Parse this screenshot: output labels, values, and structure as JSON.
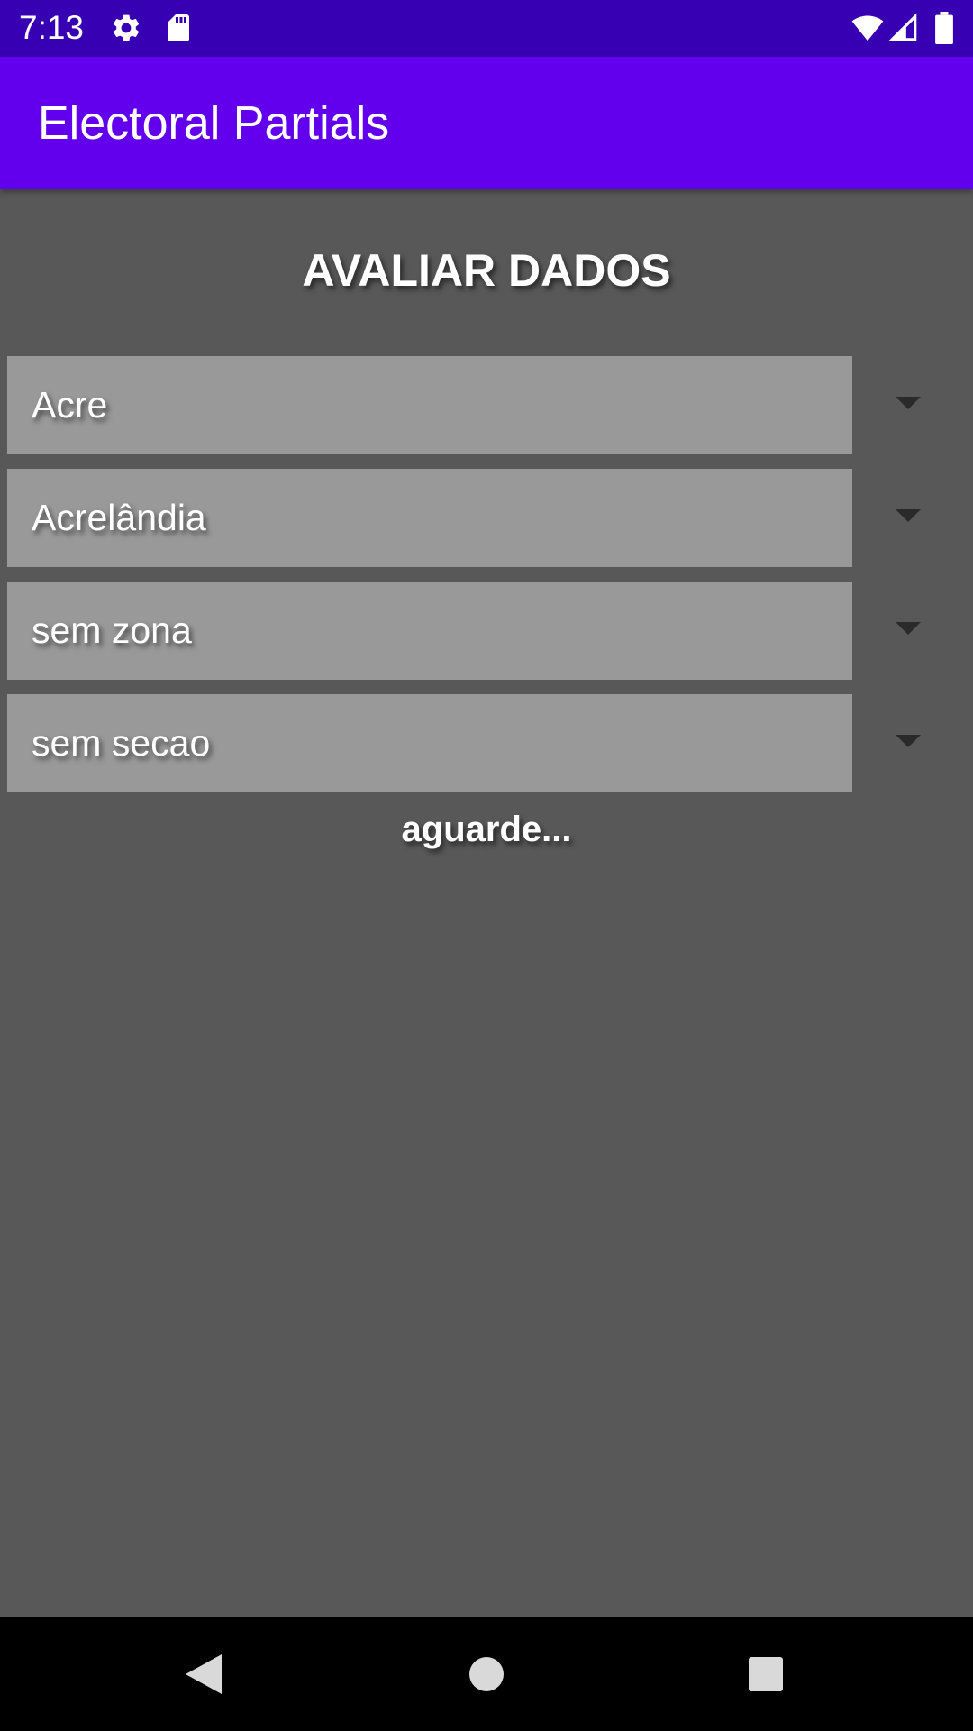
{
  "status_bar": {
    "time": "7:13",
    "icons": [
      "settings-icon",
      "sd-card-icon",
      "wifi-icon",
      "cell-signal-icon",
      "battery-icon"
    ]
  },
  "app_bar": {
    "title": "Electoral Partials",
    "color": "#6200ee"
  },
  "main": {
    "heading": "AVALIAR DADOS",
    "dropdowns": [
      {
        "selected": "Acre"
      },
      {
        "selected": "Acrelândia"
      },
      {
        "selected": "sem zona"
      },
      {
        "selected": "sem secao"
      }
    ],
    "loading_text": "aguarde..."
  },
  "navigation_bar": {
    "icons": [
      "back-icon",
      "home-icon",
      "recents-icon"
    ]
  },
  "colors": {
    "status_bar": "#3700b3",
    "app_bar": "#6200ee",
    "background": "#585858",
    "dropdown": "#999999"
  }
}
